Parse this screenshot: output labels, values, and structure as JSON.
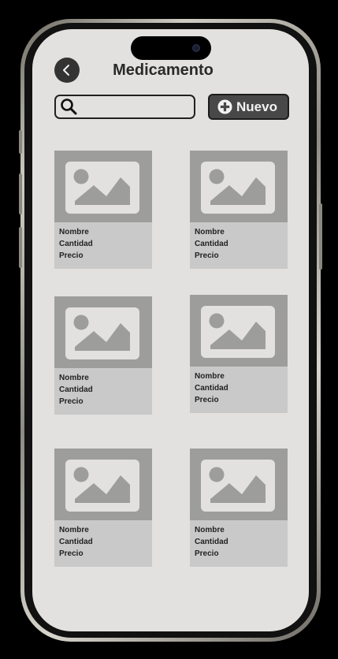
{
  "header": {
    "title": "Medicamento",
    "back_icon": "chevron-left-icon"
  },
  "search": {
    "placeholder": "",
    "value": "",
    "icon": "search-icon"
  },
  "new_button": {
    "label": "Nuevo",
    "icon": "plus-circle-icon"
  },
  "cards": [
    {
      "name_label": "Nombre",
      "quantity_label": "Cantidad",
      "price_label": "Precio",
      "image_icon": "image-placeholder-icon"
    },
    {
      "name_label": "Nombre",
      "quantity_label": "Cantidad",
      "price_label": "Precio",
      "image_icon": "image-placeholder-icon"
    },
    {
      "name_label": "Nombre",
      "quantity_label": "Cantidad",
      "price_label": "Precio",
      "image_icon": "image-placeholder-icon"
    },
    {
      "name_label": "Nombre",
      "quantity_label": "Cantidad",
      "price_label": "Precio",
      "image_icon": "image-placeholder-icon"
    },
    {
      "name_label": "Nombre",
      "quantity_label": "Cantidad",
      "price_label": "Precio",
      "image_icon": "image-placeholder-icon"
    },
    {
      "name_label": "Nombre",
      "quantity_label": "Cantidad",
      "price_label": "Precio",
      "image_icon": "image-placeholder-icon"
    }
  ],
  "colors": {
    "screen_background": "#e2e1e0",
    "card_background": "#cac9c9",
    "image_background": "#9d9d9c",
    "button_background": "#484848",
    "text_dark": "#2a2a2a"
  }
}
